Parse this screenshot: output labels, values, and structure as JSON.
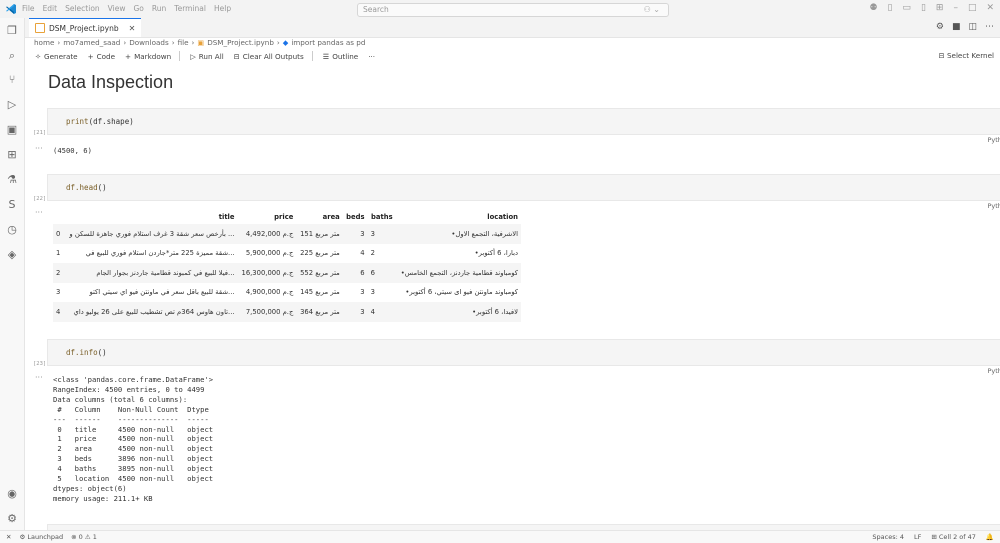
{
  "menu": [
    "File",
    "Edit",
    "Selection",
    "View",
    "Go",
    "Run",
    "Terminal",
    "Help"
  ],
  "search_placeholder": "Search",
  "tab": {
    "name": "DSM_Project.ipynb"
  },
  "breadcrumb": [
    "home",
    "mo7amed_saad",
    "Downloads",
    "file",
    "DSM_Project.ipynb",
    "import pandas as pd"
  ],
  "toolbar": {
    "generate": "Generate",
    "code": "Code",
    "markdown": "Markdown",
    "run_all": "Run All",
    "clear": "Clear All Outputs",
    "outline": "Outline",
    "more": "···"
  },
  "kernel": "Select Kernel",
  "heading": "Data Inspection",
  "cells": [
    {
      "exec": "[21]",
      "code_fn": "print",
      "code_rest": "(df.shape)",
      "lang": "Python",
      "output": "(4500, 6)"
    },
    {
      "exec": "[22]",
      "code_fn": "df.head",
      "code_rest": "()",
      "lang": "Python"
    },
    {
      "exec": "[23]",
      "code_fn": "df.info",
      "code_rest": "()",
      "lang": "Python"
    }
  ],
  "dataframe": {
    "columns": [
      "",
      "title",
      "price",
      "area",
      "beds",
      "baths",
      "location"
    ],
    "rows": [
      [
        "0",
        "بأرخص سعر شقة 3 غرف استلام فوري جاهزة للسكن و ...",
        "ج.م 4,492,000",
        "متر مربع 151",
        "3",
        "3",
        "•الاشرفية، التجمع الاول"
      ],
      [
        "1",
        "شقة مميزة 225 متر*جاردن استلام فوري للبيع في...",
        "ج.م 5,900,000",
        "متر مربع 225",
        "4",
        "2",
        "•دبارا، 6 أكتوبر"
      ],
      [
        "2",
        "فيلا للبيع في كمبوند قطامية جاردنز بجوار الجام...",
        "ج.م 16,300,000",
        "متر مربع 552",
        "6",
        "6",
        "•كومباوند قطامية جاردنز، التجمع الخامس"
      ],
      [
        "3",
        "شقة للبيع باقل سعر في ماونتن فيو اي سيتي اكتو...",
        "ج.م 4,900,000",
        "متر مربع 145",
        "3",
        "3",
        "•كومباوند ماونتن فيو اى سيتي، 6 أكتوبر"
      ],
      [
        "4",
        "تاون هاوس 364م تص تشطيب للبيع على 26 يوليو داي...",
        "ج.م 7,500,000",
        "متر مربع 364",
        "3",
        "4",
        "•لافيدا، 6 أكتوبر"
      ]
    ]
  },
  "info_output": "<class 'pandas.core.frame.DataFrame'>\nRangeIndex: 4500 entries, 0 to 4499\nData columns (total 6 columns):\n #   Column    Non-Null Count  Dtype \n---  ------    --------------  ----- \n 0   title     4500 non-null   object\n 1   price     4500 non-null   object\n 2   area      4500 non-null   object\n 3   beds      3896 non-null   object\n 4   baths     3895 non-null   object\n 5   location  4500 non-null   object\ndtypes: object(6)\nmemory usage: 211.1+ KB",
  "status": {
    "launchpad": "Launchpad",
    "problems": "0",
    "warnings": "1",
    "spaces": "Spaces: 4",
    "eol": "LF",
    "cell": "Cell 2 of 47"
  }
}
